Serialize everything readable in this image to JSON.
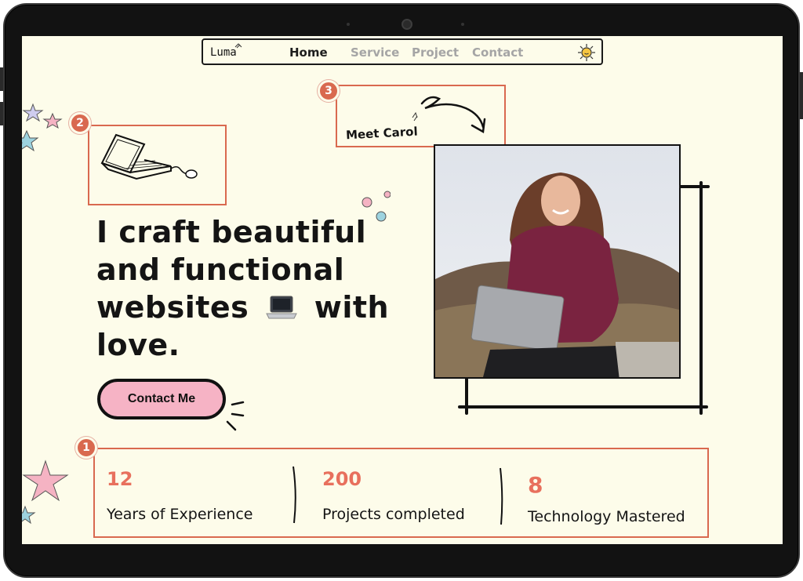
{
  "nav": {
    "brand": "Luma",
    "links": [
      {
        "label": "Home",
        "active": true
      },
      {
        "label": "Service",
        "active": false
      },
      {
        "label": "Project",
        "active": false
      },
      {
        "label": "Contact",
        "active": false
      }
    ],
    "theme_icon": "sun-icon"
  },
  "annotations": {
    "badge_1": "1",
    "badge_2": "2",
    "badge_3": "3",
    "color": "#d9694f"
  },
  "hero": {
    "headline_pre": "I craft ",
    "headline_highlight": "beautiful",
    "headline_line2": "and functional",
    "headline_line3_a": "websites",
    "headline_line3_emoji": "laptop-icon",
    "headline_line3_b": "with",
    "headline_line4": "love.",
    "cta_label": "Contact Me",
    "meet_label": "Meet Carol",
    "photo_icon": "portrait-photo"
  },
  "stats": [
    {
      "value": "12",
      "label": "Years of Experience"
    },
    {
      "value": "200",
      "label": "Projects completed"
    },
    {
      "value": "8",
      "label": "Technology Mastered"
    }
  ],
  "colors": {
    "background": "#fdfcea",
    "accent_pink": "#f6b3c5",
    "accent_blue": "#a8dde8",
    "stat_number": "#e8705d",
    "ink": "#141414"
  }
}
